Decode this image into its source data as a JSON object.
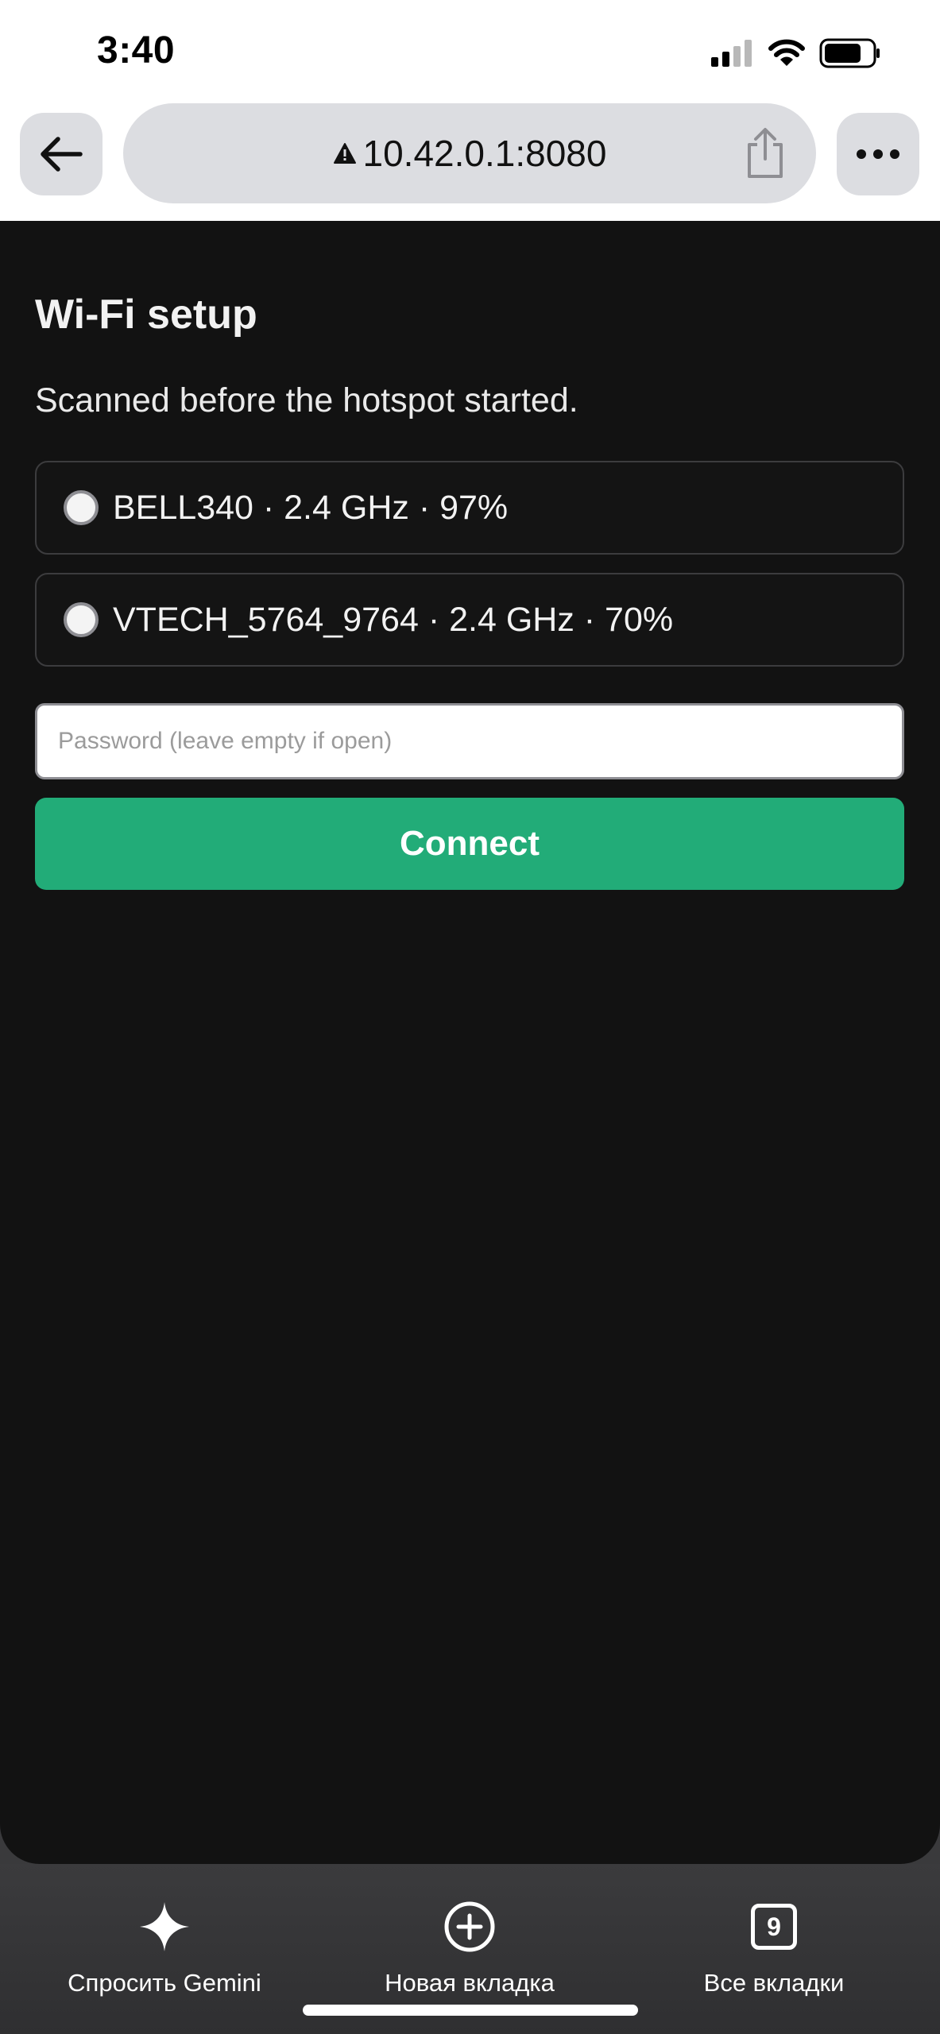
{
  "status_bar": {
    "time": "3:40"
  },
  "browser": {
    "url": "10.42.0.1:8080",
    "security_icon": "warning-triangle-icon"
  },
  "page": {
    "title": "Wi-Fi setup",
    "subtitle": "Scanned before the hotspot started.",
    "networks": [
      {
        "label": "BELL340 · 2.4 GHz · 97%",
        "selected": false
      },
      {
        "label": "VTECH_5764_9764 · 2.4 GHz · 70%",
        "selected": false
      }
    ],
    "password": {
      "value": "",
      "placeholder": "Password (leave empty if open)"
    },
    "connect_label": "Connect",
    "accent_color": "#22ac78"
  },
  "bottom_bar": {
    "gemini_label": "Спросить Gemini",
    "new_tab_label": "Новая вкладка",
    "all_tabs_label": "Все вкладки",
    "tab_count": "9"
  }
}
